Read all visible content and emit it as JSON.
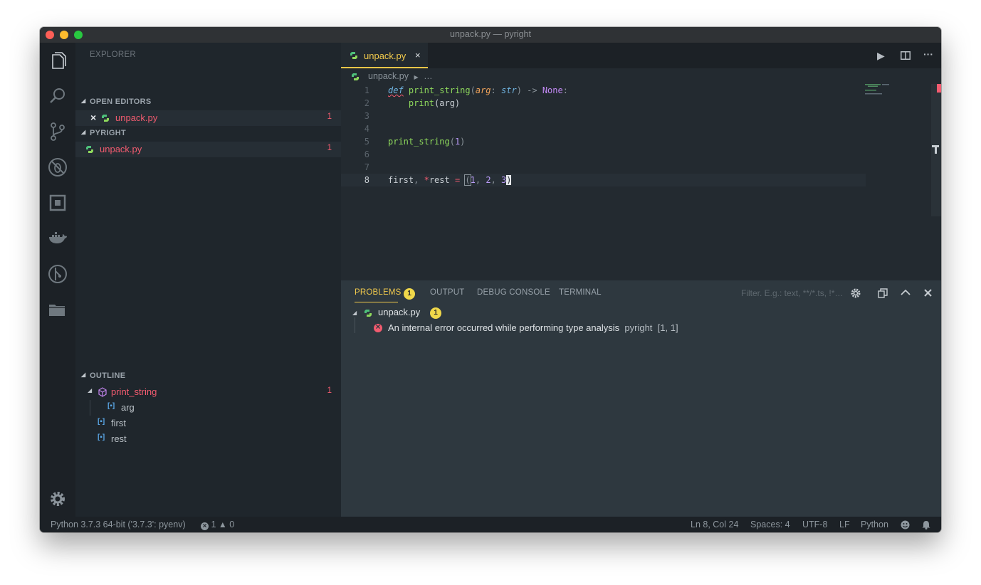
{
  "window": {
    "title": "unpack.py — pyright"
  },
  "sidebar": {
    "title": "EXPLORER",
    "open_editors": {
      "label": "OPEN EDITORS",
      "items": [
        {
          "name": "unpack.py",
          "count": "1"
        }
      ]
    },
    "project": {
      "label": "PYRIGHT",
      "items": [
        {
          "name": "unpack.py",
          "count": "1"
        }
      ]
    },
    "outline": {
      "label": "OUTLINE",
      "items": [
        {
          "name": "print_string",
          "count": "1"
        },
        {
          "name": "arg"
        },
        {
          "name": "first"
        },
        {
          "name": "rest"
        }
      ]
    }
  },
  "editor": {
    "tab": {
      "label": "unpack.py",
      "close": "×"
    },
    "breadcrumb": {
      "file": "unpack.py",
      "more": "…"
    },
    "line_numbers": [
      "1",
      "2",
      "3",
      "4",
      "5",
      "6",
      "7",
      "8"
    ],
    "code": {
      "l1": {
        "kw": "def",
        "fn": "print_string",
        "p1": "(",
        "param": "arg",
        "colon": ": ",
        "typ": "str",
        "p2": ")",
        "arrow": " -> ",
        "none": "None",
        "end": ":"
      },
      "l2": {
        "indent": "    ",
        "call": "print",
        "args": "(arg)"
      },
      "l5": {
        "call": "print_string",
        "open": "(",
        "arg": "1",
        "close": ")"
      },
      "l8": {
        "a": "first",
        "comma": ", ",
        "star": "*",
        "b": "rest",
        "eq": " = ",
        "open": "(",
        "n1": "1",
        "c1": ", ",
        "n2": "2",
        "c2": ", ",
        "n3": "3",
        "close": ")"
      }
    }
  },
  "panel": {
    "tabs": [
      "PROBLEMS",
      "OUTPUT",
      "DEBUG CONSOLE",
      "TERMINAL"
    ],
    "problems_count": "1",
    "filter_placeholder": "Filter. E.g.: text, **/*.ts, !*…",
    "problem": {
      "file": "unpack.py",
      "file_count": "1",
      "message": "An internal error occurred while performing type analysis",
      "source": "pyright",
      "position": "[1, 1]"
    }
  },
  "statusbar": {
    "interpreter": "Python 3.7.3 64-bit ('3.7.3': pyenv)",
    "errors": "1",
    "warnings": "0",
    "cursor": "Ln 8, Col 24",
    "spaces": "Spaces: 4",
    "encoding": "UTF-8",
    "eol": "LF",
    "language": "Python"
  },
  "colors": {
    "accent": "#f0c94c",
    "error": "#f25b6f",
    "background": "#1e2429"
  }
}
